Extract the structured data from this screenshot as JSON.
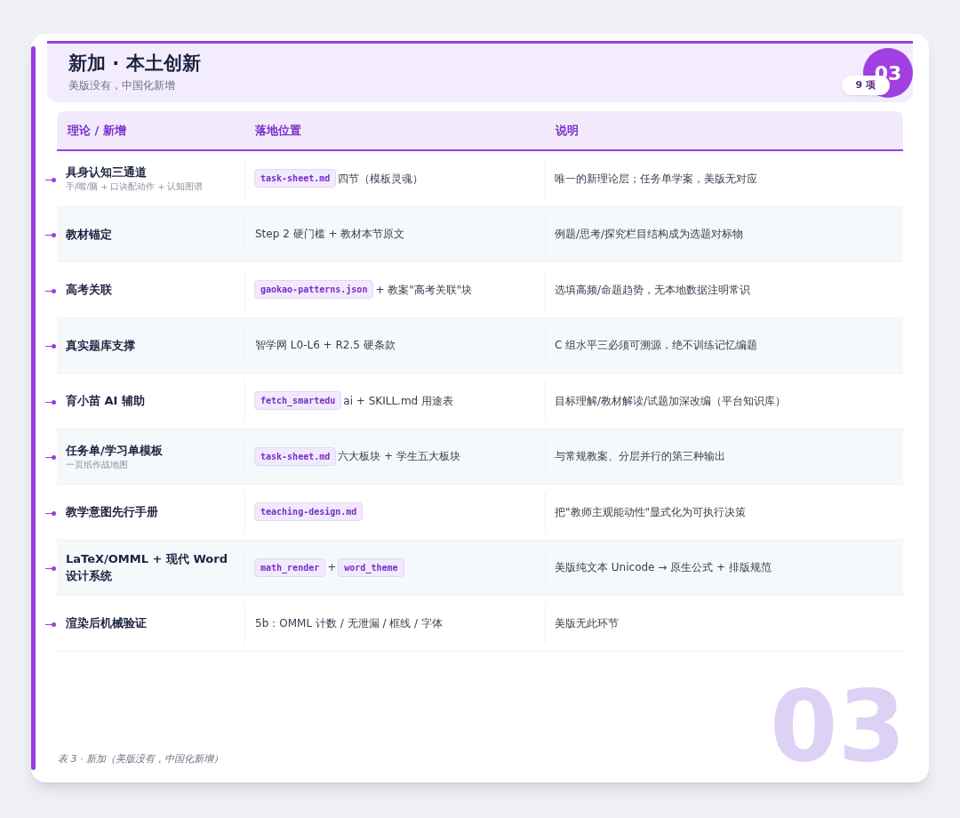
{
  "header": {
    "title": "新加 · 本土创新",
    "subtitle": "美版没有，中国化新增",
    "badge_number": "03",
    "count_badge": "9 项"
  },
  "table": {
    "columns": [
      "理论 / 新增",
      "落地位置",
      "说明"
    ],
    "rows": [
      {
        "title": "具身认知三通道",
        "subtitle": "手/嘴/脑 + 口诀配动作 + 认知图谱",
        "location": [
          {
            "kind": "code",
            "text": "task-sheet.md"
          },
          {
            "kind": "text",
            "text": "四节（模板灵魂）"
          }
        ],
        "note": "唯一的新理论层；任务单学案，美版无对应"
      },
      {
        "title": "教材锚定",
        "location": [
          {
            "kind": "text",
            "text": "Step 2 硬门槛 + 教材本节原文"
          }
        ],
        "note": "例题/思考/探究栏目结构成为选题对标物"
      },
      {
        "title": "高考关联",
        "location": [
          {
            "kind": "code",
            "text": "gaokao-patterns.json"
          },
          {
            "kind": "text",
            "text": "+ 教案\"高考关联\"块"
          }
        ],
        "note": "选填高频/命题趋势，无本地数据注明常识"
      },
      {
        "title": "真实题库支撑",
        "location": [
          {
            "kind": "text",
            "text": "智学网 L0-L6 + R2.5 硬条款"
          }
        ],
        "note": "C 组水平三必须可溯源，绝不训练记忆编题"
      },
      {
        "title": "育小苗 AI 辅助",
        "location": [
          {
            "kind": "code",
            "text": "fetch_smartedu"
          },
          {
            "kind": "text",
            "text": "ai + SKILL.md 用途表"
          }
        ],
        "note": "目标理解/教材解读/试题加深改编（平台知识库）"
      },
      {
        "title": "任务单/学习单模板",
        "subtitle": "一页纸作战地图",
        "location": [
          {
            "kind": "code",
            "text": "task-sheet.md"
          },
          {
            "kind": "text",
            "text": "六大板块 + 学生五大板块"
          }
        ],
        "note": "与常规教案、分层并行的第三种输出"
      },
      {
        "title": "教学意图先行手册",
        "location": [
          {
            "kind": "code",
            "text": "teaching-design.md"
          }
        ],
        "note": "把\"教师主观能动性\"显式化为可执行决策"
      },
      {
        "title": "LaTeX/OMML + 现代 Word 设计系统",
        "location": [
          {
            "kind": "code",
            "text": "math_render"
          },
          {
            "kind": "text",
            "text": "+"
          },
          {
            "kind": "code",
            "text": "word_theme"
          }
        ],
        "note": "美版纯文本 Unicode → 原生公式 + 排版规范"
      },
      {
        "title": "渲染后机械验证",
        "location": [
          {
            "kind": "text",
            "text": "5b：OMML 计数 / 无泄漏 / 框线 / 字体"
          }
        ],
        "note": "美版无此环节"
      }
    ]
  },
  "caption": "表 3 · 新加（美版没有，中国化新增）",
  "background_number": "03"
}
